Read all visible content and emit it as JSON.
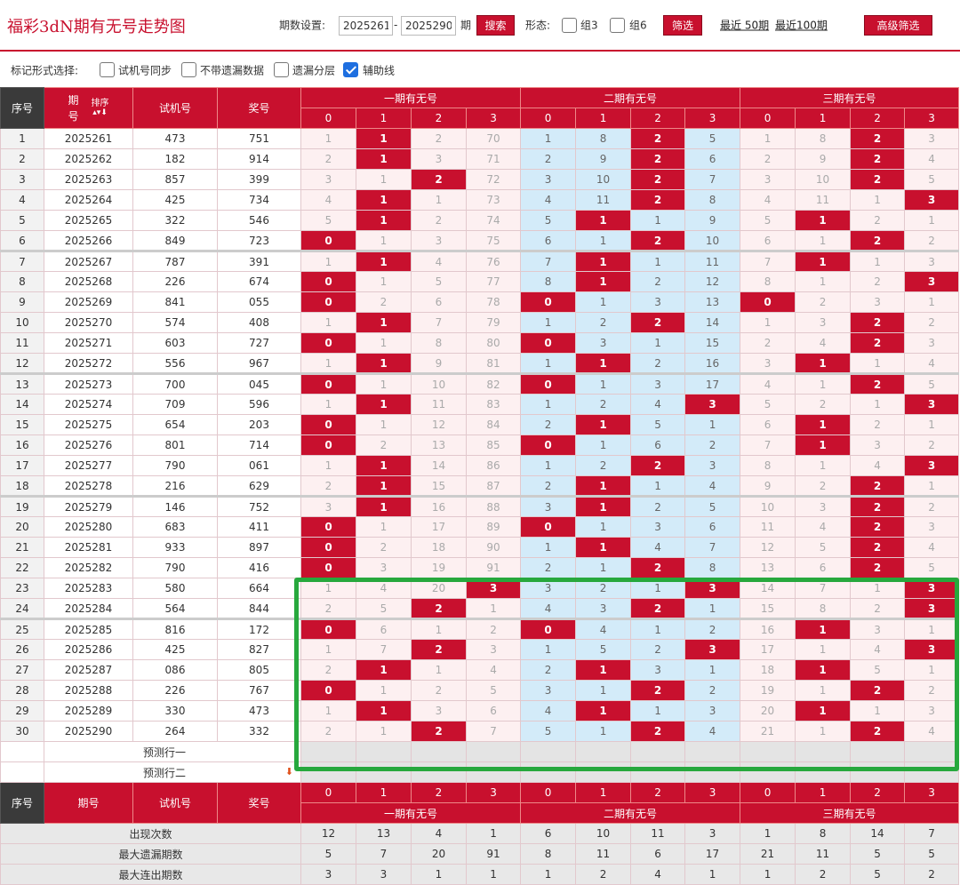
{
  "header": {
    "title": "福彩3dN期有无号走势图",
    "period_label": "期数设置:",
    "period_from": "2025261",
    "period_dash": "-",
    "period_to": "2025290",
    "period_unit": "期",
    "search_label": "搜索",
    "form_label": "形态:",
    "zu3_label": "组3",
    "zu6_label": "组6",
    "filter_label": "筛选",
    "recent50_label": "最近 50期",
    "recent100_label": "最近100期",
    "advanced_label": "高级筛选"
  },
  "marking": {
    "label": "标记形式选择:",
    "opt1": "试机号同步",
    "opt2": "不带遗漏数据",
    "opt3": "遗漏分层",
    "opt4": "辅助线"
  },
  "table": {
    "h_seq": "序号",
    "h_issue1": "期",
    "h_issue2": "号",
    "h_sort": "排序",
    "h_trial": "试机号",
    "h_prize": "奖号",
    "groups": [
      "一期有无号",
      "二期有无号",
      "三期有无号"
    ],
    "sub": [
      "0",
      "1",
      "2",
      "3"
    ],
    "h_issue_full": "期号",
    "pred1": "预测行一",
    "pred2": "预测行二",
    "stat_labels": [
      "出现次数",
      "最大遗漏期数",
      "最大连出期数"
    ],
    "stats": [
      [
        12,
        13,
        4,
        1,
        6,
        10,
        11,
        3,
        1,
        8,
        14,
        7
      ],
      [
        5,
        7,
        20,
        91,
        8,
        11,
        6,
        17,
        21,
        11,
        5,
        5
      ],
      [
        3,
        3,
        1,
        1,
        1,
        2,
        4,
        1,
        1,
        2,
        5,
        2
      ]
    ],
    "rows": [
      {
        "seq": "1",
        "issue": "2025261",
        "trial": "473",
        "prize": "751",
        "v": [
          "1",
          "1",
          "2",
          "70",
          "1",
          "8",
          "2",
          "5",
          "1",
          "8",
          "2",
          "3"
        ],
        "h": [
          0,
          1,
          0,
          0,
          0,
          0,
          1,
          0,
          0,
          0,
          1,
          0
        ]
      },
      {
        "seq": "2",
        "issue": "2025262",
        "trial": "182",
        "prize": "914",
        "v": [
          "2",
          "1",
          "3",
          "71",
          "2",
          "9",
          "2",
          "6",
          "2",
          "9",
          "2",
          "4"
        ],
        "h": [
          0,
          1,
          0,
          0,
          0,
          0,
          1,
          0,
          0,
          0,
          1,
          0
        ]
      },
      {
        "seq": "3",
        "issue": "2025263",
        "trial": "857",
        "prize": "399",
        "v": [
          "3",
          "1",
          "2",
          "72",
          "3",
          "10",
          "2",
          "7",
          "3",
          "10",
          "2",
          "5"
        ],
        "h": [
          0,
          0,
          1,
          0,
          0,
          0,
          1,
          0,
          0,
          0,
          1,
          0
        ]
      },
      {
        "seq": "4",
        "issue": "2025264",
        "trial": "425",
        "prize": "734",
        "v": [
          "4",
          "1",
          "1",
          "73",
          "4",
          "11",
          "2",
          "8",
          "4",
          "11",
          "1",
          "3"
        ],
        "h": [
          0,
          1,
          0,
          0,
          0,
          0,
          1,
          0,
          0,
          0,
          0,
          1
        ]
      },
      {
        "seq": "5",
        "issue": "2025265",
        "trial": "322",
        "prize": "546",
        "v": [
          "5",
          "1",
          "2",
          "74",
          "5",
          "1",
          "1",
          "9",
          "5",
          "1",
          "2",
          "1"
        ],
        "h": [
          0,
          1,
          0,
          0,
          0,
          1,
          0,
          0,
          0,
          1,
          0,
          0
        ]
      },
      {
        "seq": "6",
        "issue": "2025266",
        "trial": "849",
        "prize": "723",
        "v": [
          "0",
          "1",
          "3",
          "75",
          "6",
          "1",
          "2",
          "10",
          "6",
          "1",
          "2",
          "2"
        ],
        "h": [
          1,
          0,
          0,
          0,
          0,
          0,
          1,
          0,
          0,
          0,
          1,
          0
        ]
      },
      {
        "seq": "7",
        "issue": "2025267",
        "trial": "787",
        "prize": "391",
        "v": [
          "1",
          "1",
          "4",
          "76",
          "7",
          "1",
          "1",
          "11",
          "7",
          "1",
          "1",
          "3"
        ],
        "h": [
          0,
          1,
          0,
          0,
          0,
          1,
          0,
          0,
          0,
          1,
          0,
          0
        ]
      },
      {
        "seq": "8",
        "issue": "2025268",
        "trial": "226",
        "prize": "674",
        "v": [
          "0",
          "1",
          "5",
          "77",
          "8",
          "1",
          "2",
          "12",
          "8",
          "1",
          "2",
          "3"
        ],
        "h": [
          1,
          0,
          0,
          0,
          0,
          1,
          0,
          0,
          0,
          0,
          0,
          1
        ]
      },
      {
        "seq": "9",
        "issue": "2025269",
        "trial": "841",
        "prize": "055",
        "v": [
          "0",
          "2",
          "6",
          "78",
          "0",
          "1",
          "3",
          "13",
          "0",
          "2",
          "3",
          "1"
        ],
        "h": [
          1,
          0,
          0,
          0,
          1,
          0,
          0,
          0,
          1,
          0,
          0,
          0
        ]
      },
      {
        "seq": "10",
        "issue": "2025270",
        "trial": "574",
        "prize": "408",
        "v": [
          "1",
          "1",
          "7",
          "79",
          "1",
          "2",
          "2",
          "14",
          "1",
          "3",
          "2",
          "2"
        ],
        "h": [
          0,
          1,
          0,
          0,
          0,
          0,
          1,
          0,
          0,
          0,
          1,
          0
        ]
      },
      {
        "seq": "11",
        "issue": "2025271",
        "trial": "603",
        "prize": "727",
        "v": [
          "0",
          "1",
          "8",
          "80",
          "0",
          "3",
          "1",
          "15",
          "2",
          "4",
          "2",
          "3"
        ],
        "h": [
          1,
          0,
          0,
          0,
          1,
          0,
          0,
          0,
          0,
          0,
          1,
          0
        ]
      },
      {
        "seq": "12",
        "issue": "2025272",
        "trial": "556",
        "prize": "967",
        "v": [
          "1",
          "1",
          "9",
          "81",
          "1",
          "1",
          "2",
          "16",
          "3",
          "1",
          "1",
          "4"
        ],
        "h": [
          0,
          1,
          0,
          0,
          0,
          1,
          0,
          0,
          0,
          1,
          0,
          0
        ]
      },
      {
        "seq": "13",
        "issue": "2025273",
        "trial": "700",
        "prize": "045",
        "v": [
          "0",
          "1",
          "10",
          "82",
          "0",
          "1",
          "3",
          "17",
          "4",
          "1",
          "2",
          "5"
        ],
        "h": [
          1,
          0,
          0,
          0,
          1,
          0,
          0,
          0,
          0,
          0,
          1,
          0
        ]
      },
      {
        "seq": "14",
        "issue": "2025274",
        "trial": "709",
        "prize": "596",
        "v": [
          "1",
          "1",
          "11",
          "83",
          "1",
          "2",
          "4",
          "3",
          "5",
          "2",
          "1",
          "3"
        ],
        "h": [
          0,
          1,
          0,
          0,
          0,
          0,
          0,
          1,
          0,
          0,
          0,
          1
        ]
      },
      {
        "seq": "15",
        "issue": "2025275",
        "trial": "654",
        "prize": "203",
        "v": [
          "0",
          "1",
          "12",
          "84",
          "2",
          "1",
          "5",
          "1",
          "6",
          "1",
          "2",
          "1"
        ],
        "h": [
          1,
          0,
          0,
          0,
          0,
          1,
          0,
          0,
          0,
          1,
          0,
          0
        ]
      },
      {
        "seq": "16",
        "issue": "2025276",
        "trial": "801",
        "prize": "714",
        "v": [
          "0",
          "2",
          "13",
          "85",
          "0",
          "1",
          "6",
          "2",
          "7",
          "1",
          "3",
          "2"
        ],
        "h": [
          1,
          0,
          0,
          0,
          1,
          0,
          0,
          0,
          0,
          1,
          0,
          0
        ]
      },
      {
        "seq": "17",
        "issue": "2025277",
        "trial": "790",
        "prize": "061",
        "v": [
          "1",
          "1",
          "14",
          "86",
          "1",
          "2",
          "2",
          "3",
          "8",
          "1",
          "4",
          "3"
        ],
        "h": [
          0,
          1,
          0,
          0,
          0,
          0,
          1,
          0,
          0,
          0,
          0,
          1
        ]
      },
      {
        "seq": "18",
        "issue": "2025278",
        "trial": "216",
        "prize": "629",
        "v": [
          "2",
          "1",
          "15",
          "87",
          "2",
          "1",
          "1",
          "4",
          "9",
          "2",
          "2",
          "1"
        ],
        "h": [
          0,
          1,
          0,
          0,
          0,
          1,
          0,
          0,
          0,
          0,
          1,
          0
        ]
      },
      {
        "seq": "19",
        "issue": "2025279",
        "trial": "146",
        "prize": "752",
        "v": [
          "3",
          "1",
          "16",
          "88",
          "3",
          "1",
          "2",
          "5",
          "10",
          "3",
          "2",
          "2"
        ],
        "h": [
          0,
          1,
          0,
          0,
          0,
          1,
          0,
          0,
          0,
          0,
          1,
          0
        ]
      },
      {
        "seq": "20",
        "issue": "2025280",
        "trial": "683",
        "prize": "411",
        "v": [
          "0",
          "1",
          "17",
          "89",
          "0",
          "1",
          "3",
          "6",
          "11",
          "4",
          "2",
          "3"
        ],
        "h": [
          1,
          0,
          0,
          0,
          1,
          0,
          0,
          0,
          0,
          0,
          1,
          0
        ]
      },
      {
        "seq": "21",
        "issue": "2025281",
        "trial": "933",
        "prize": "897",
        "v": [
          "0",
          "2",
          "18",
          "90",
          "1",
          "1",
          "4",
          "7",
          "12",
          "5",
          "2",
          "4"
        ],
        "h": [
          1,
          0,
          0,
          0,
          0,
          1,
          0,
          0,
          0,
          0,
          1,
          0
        ]
      },
      {
        "seq": "22",
        "issue": "2025282",
        "trial": "790",
        "prize": "416",
        "v": [
          "0",
          "3",
          "19",
          "91",
          "2",
          "1",
          "2",
          "8",
          "13",
          "6",
          "2",
          "5"
        ],
        "h": [
          1,
          0,
          0,
          0,
          0,
          0,
          1,
          0,
          0,
          0,
          1,
          0
        ]
      },
      {
        "seq": "23",
        "issue": "2025283",
        "trial": "580",
        "prize": "664",
        "v": [
          "1",
          "4",
          "20",
          "3",
          "3",
          "2",
          "1",
          "3",
          "14",
          "7",
          "1",
          "3"
        ],
        "h": [
          0,
          0,
          0,
          1,
          0,
          0,
          0,
          1,
          0,
          0,
          0,
          1
        ]
      },
      {
        "seq": "24",
        "issue": "2025284",
        "trial": "564",
        "prize": "844",
        "v": [
          "2",
          "5",
          "2",
          "1",
          "4",
          "3",
          "2",
          "1",
          "15",
          "8",
          "2",
          "3"
        ],
        "h": [
          0,
          0,
          1,
          0,
          0,
          0,
          1,
          0,
          0,
          0,
          0,
          1
        ]
      },
      {
        "seq": "25",
        "issue": "2025285",
        "trial": "816",
        "prize": "172",
        "v": [
          "0",
          "6",
          "1",
          "2",
          "0",
          "4",
          "1",
          "2",
          "16",
          "1",
          "3",
          "1"
        ],
        "h": [
          1,
          0,
          0,
          0,
          1,
          0,
          0,
          0,
          0,
          1,
          0,
          0
        ]
      },
      {
        "seq": "26",
        "issue": "2025286",
        "trial": "425",
        "prize": "827",
        "v": [
          "1",
          "7",
          "2",
          "3",
          "1",
          "5",
          "2",
          "3",
          "17",
          "1",
          "4",
          "3"
        ],
        "h": [
          0,
          0,
          1,
          0,
          0,
          0,
          0,
          1,
          0,
          0,
          0,
          1
        ]
      },
      {
        "seq": "27",
        "issue": "2025287",
        "trial": "086",
        "prize": "805",
        "v": [
          "2",
          "1",
          "1",
          "4",
          "2",
          "1",
          "3",
          "1",
          "18",
          "1",
          "5",
          "1"
        ],
        "h": [
          0,
          1,
          0,
          0,
          0,
          1,
          0,
          0,
          0,
          1,
          0,
          0
        ]
      },
      {
        "seq": "28",
        "issue": "2025288",
        "trial": "226",
        "prize": "767",
        "v": [
          "0",
          "1",
          "2",
          "5",
          "3",
          "1",
          "2",
          "2",
          "19",
          "1",
          "2",
          "2"
        ],
        "h": [
          1,
          0,
          0,
          0,
          0,
          0,
          1,
          0,
          0,
          0,
          1,
          0
        ]
      },
      {
        "seq": "29",
        "issue": "2025289",
        "trial": "330",
        "prize": "473",
        "v": [
          "1",
          "1",
          "3",
          "6",
          "4",
          "1",
          "1",
          "3",
          "20",
          "1",
          "1",
          "3"
        ],
        "h": [
          0,
          1,
          0,
          0,
          0,
          1,
          0,
          0,
          0,
          1,
          0,
          0
        ]
      },
      {
        "seq": "30",
        "issue": "2025290",
        "trial": "264",
        "prize": "332",
        "v": [
          "2",
          "1",
          "2",
          "7",
          "5",
          "1",
          "2",
          "4",
          "21",
          "1",
          "2",
          "4"
        ],
        "h": [
          0,
          0,
          1,
          0,
          0,
          0,
          1,
          0,
          0,
          0,
          1,
          0
        ]
      }
    ]
  }
}
